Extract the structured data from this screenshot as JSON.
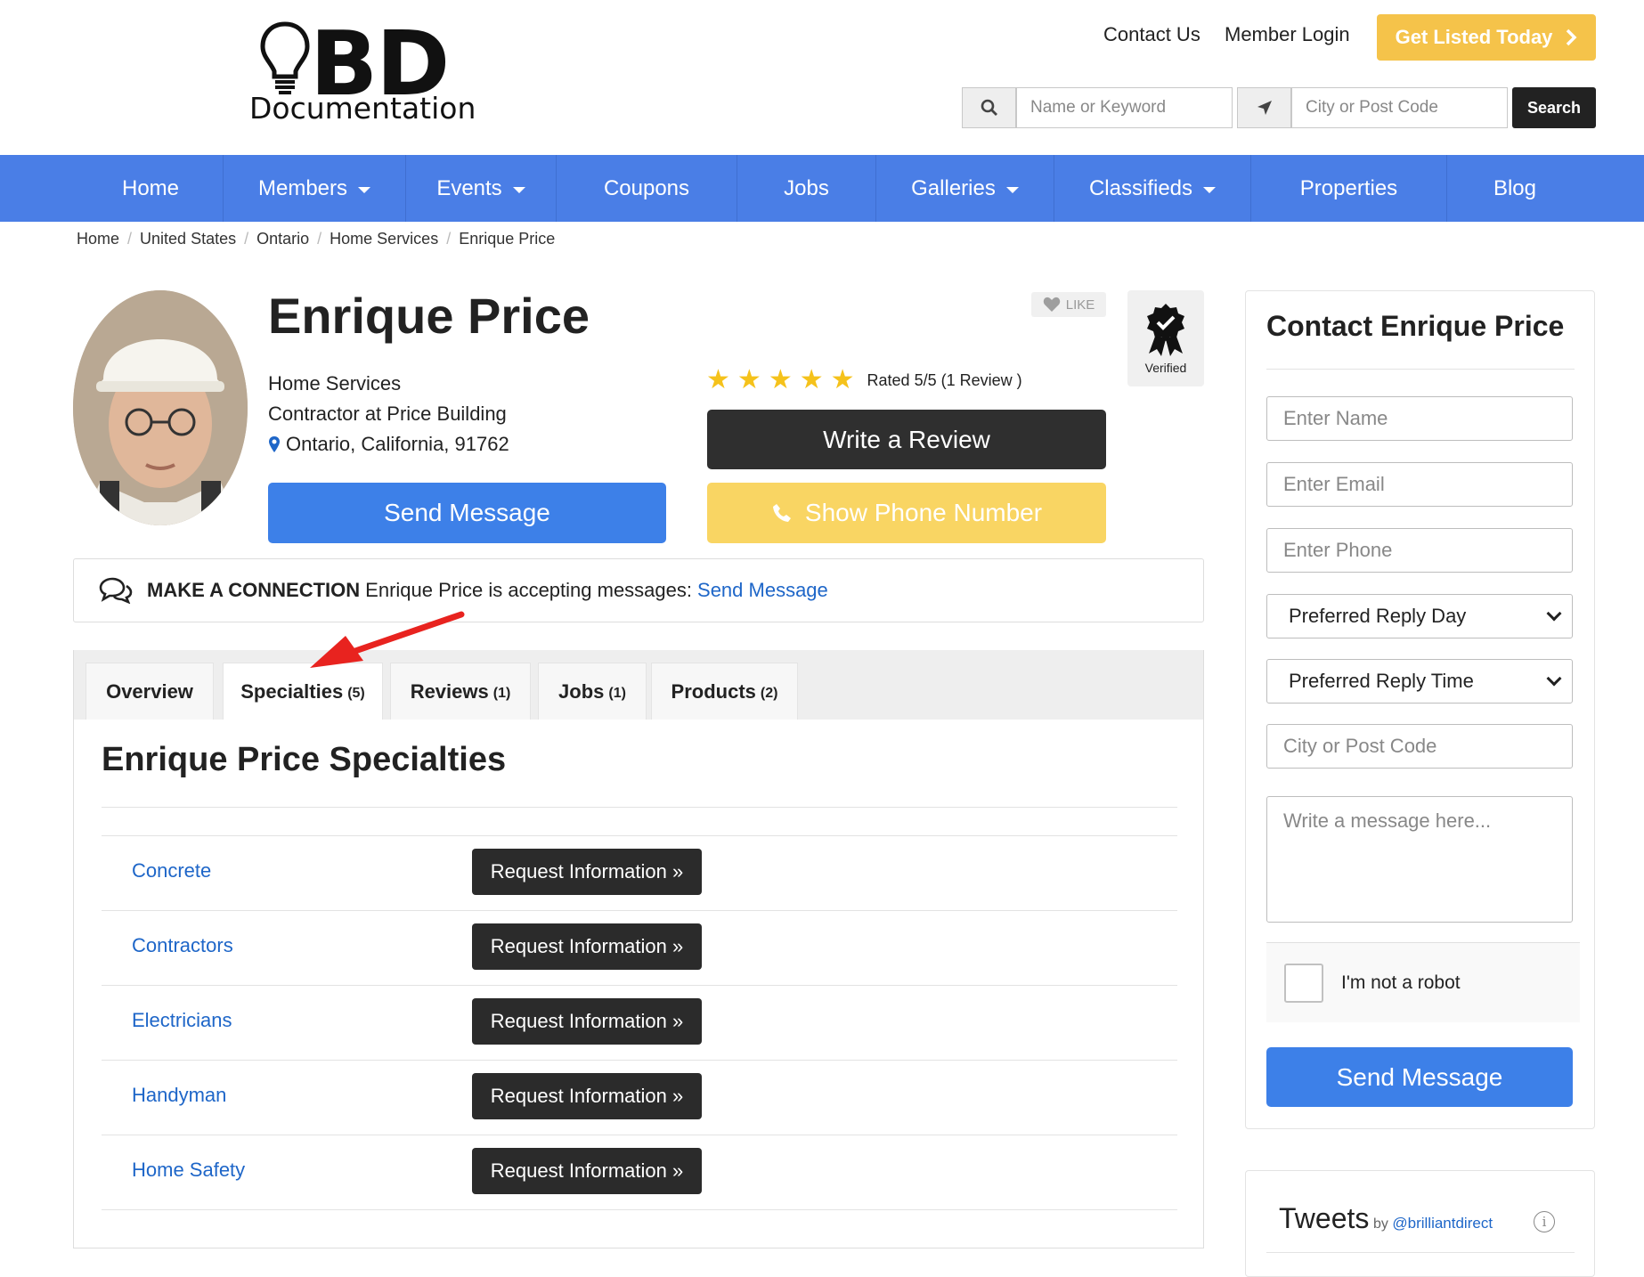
{
  "header": {
    "logo_main": "BD",
    "logo_sub": "Documentation",
    "contact_link": "Contact Us",
    "login_link": "Member Login",
    "cta_button": "Get Listed Today",
    "search": {
      "keyword_placeholder": "Name or Keyword",
      "location_placeholder": "City or Post Code",
      "button_label": "Search"
    }
  },
  "nav": {
    "items": [
      {
        "label": "Home",
        "dropdown": false
      },
      {
        "label": "Members",
        "dropdown": true
      },
      {
        "label": "Events",
        "dropdown": true
      },
      {
        "label": "Coupons",
        "dropdown": false
      },
      {
        "label": "Jobs",
        "dropdown": false
      },
      {
        "label": "Galleries",
        "dropdown": true
      },
      {
        "label": "Classifieds",
        "dropdown": true
      },
      {
        "label": "Properties",
        "dropdown": false
      },
      {
        "label": "Blog",
        "dropdown": false
      }
    ]
  },
  "breadcrumb": [
    "Home",
    "United States",
    "Ontario",
    "Home Services",
    "Enrique Price"
  ],
  "profile": {
    "name": "Enrique Price",
    "category": "Home Services",
    "title": "Contractor at Price Building",
    "location": "Ontario, California, 91762",
    "send_message": "Send Message",
    "rating_text": "Rated 5/5 (1 Review )",
    "rating_stars": 5,
    "write_review": "Write a Review",
    "show_phone": "Show Phone Number",
    "like_label": "LIKE",
    "verified_label": "Verified"
  },
  "connection": {
    "heading": "MAKE A CONNECTION",
    "text": "Enrique Price is accepting messages:",
    "link": "Send Message"
  },
  "tabs": [
    {
      "label": "Overview",
      "count": "",
      "active": false
    },
    {
      "label": "Specialties",
      "count": "(5)",
      "active": true
    },
    {
      "label": "Reviews",
      "count": "(1)",
      "active": false
    },
    {
      "label": "Jobs",
      "count": "(1)",
      "active": false
    },
    {
      "label": "Products",
      "count": "(2)",
      "active": false
    }
  ],
  "specialties": {
    "title": "Enrique Price Specialties",
    "button_label": "Request Information »",
    "items": [
      "Concrete",
      "Contractors",
      "Electricians",
      "Handyman",
      "Home Safety"
    ]
  },
  "sidebar": {
    "title": "Contact Enrique Price",
    "name_placeholder": "Enter Name",
    "email_placeholder": "Enter Email",
    "phone_placeholder": "Enter Phone",
    "reply_day": "Preferred Reply Day",
    "reply_time": "Preferred Reply Time",
    "city_placeholder": "City or Post Code",
    "message_placeholder": "Write a message here...",
    "captcha_label": "I'm not a robot",
    "send_button": "Send Message"
  },
  "tweets": {
    "title": "Tweets",
    "by": "by",
    "handle": "@brilliantdirect"
  },
  "colors": {
    "nav_blue": "#4a7ee6",
    "cta_yellow": "#f5c34a",
    "phone_yellow": "#f9d563",
    "button_blue": "#3d80e8",
    "dark_button": "#2b2b2b",
    "link_blue": "#1e66c8",
    "star_yellow": "#f5c21b",
    "annotation_arrow": "#e8231f"
  }
}
